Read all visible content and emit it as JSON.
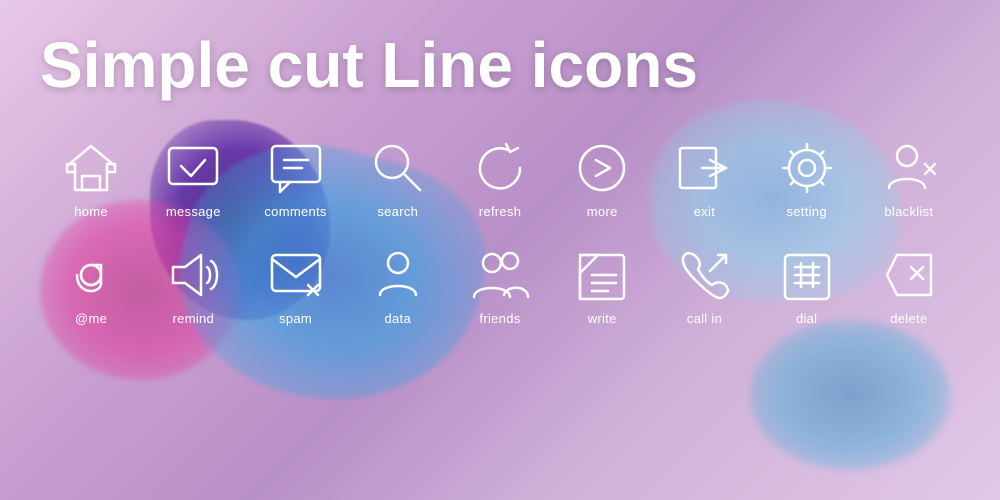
{
  "title": "Simple cut Line icons",
  "icons_row1": [
    {
      "id": "home",
      "label": "home"
    },
    {
      "id": "message",
      "label": "message"
    },
    {
      "id": "comments",
      "label": "comments"
    },
    {
      "id": "search",
      "label": "search"
    },
    {
      "id": "refresh",
      "label": "refresh"
    },
    {
      "id": "more",
      "label": "more"
    },
    {
      "id": "exit",
      "label": "exit"
    },
    {
      "id": "setting",
      "label": "setting"
    },
    {
      "id": "blacklist",
      "label": "blacklist"
    }
  ],
  "icons_row2": [
    {
      "id": "at-me",
      "label": "@me"
    },
    {
      "id": "remind",
      "label": "remind"
    },
    {
      "id": "spam",
      "label": "spam"
    },
    {
      "id": "data",
      "label": "data"
    },
    {
      "id": "friends",
      "label": "friends"
    },
    {
      "id": "write",
      "label": "write"
    },
    {
      "id": "call-in",
      "label": "call in"
    },
    {
      "id": "dial",
      "label": "dial"
    },
    {
      "id": "delete",
      "label": "delete"
    }
  ]
}
